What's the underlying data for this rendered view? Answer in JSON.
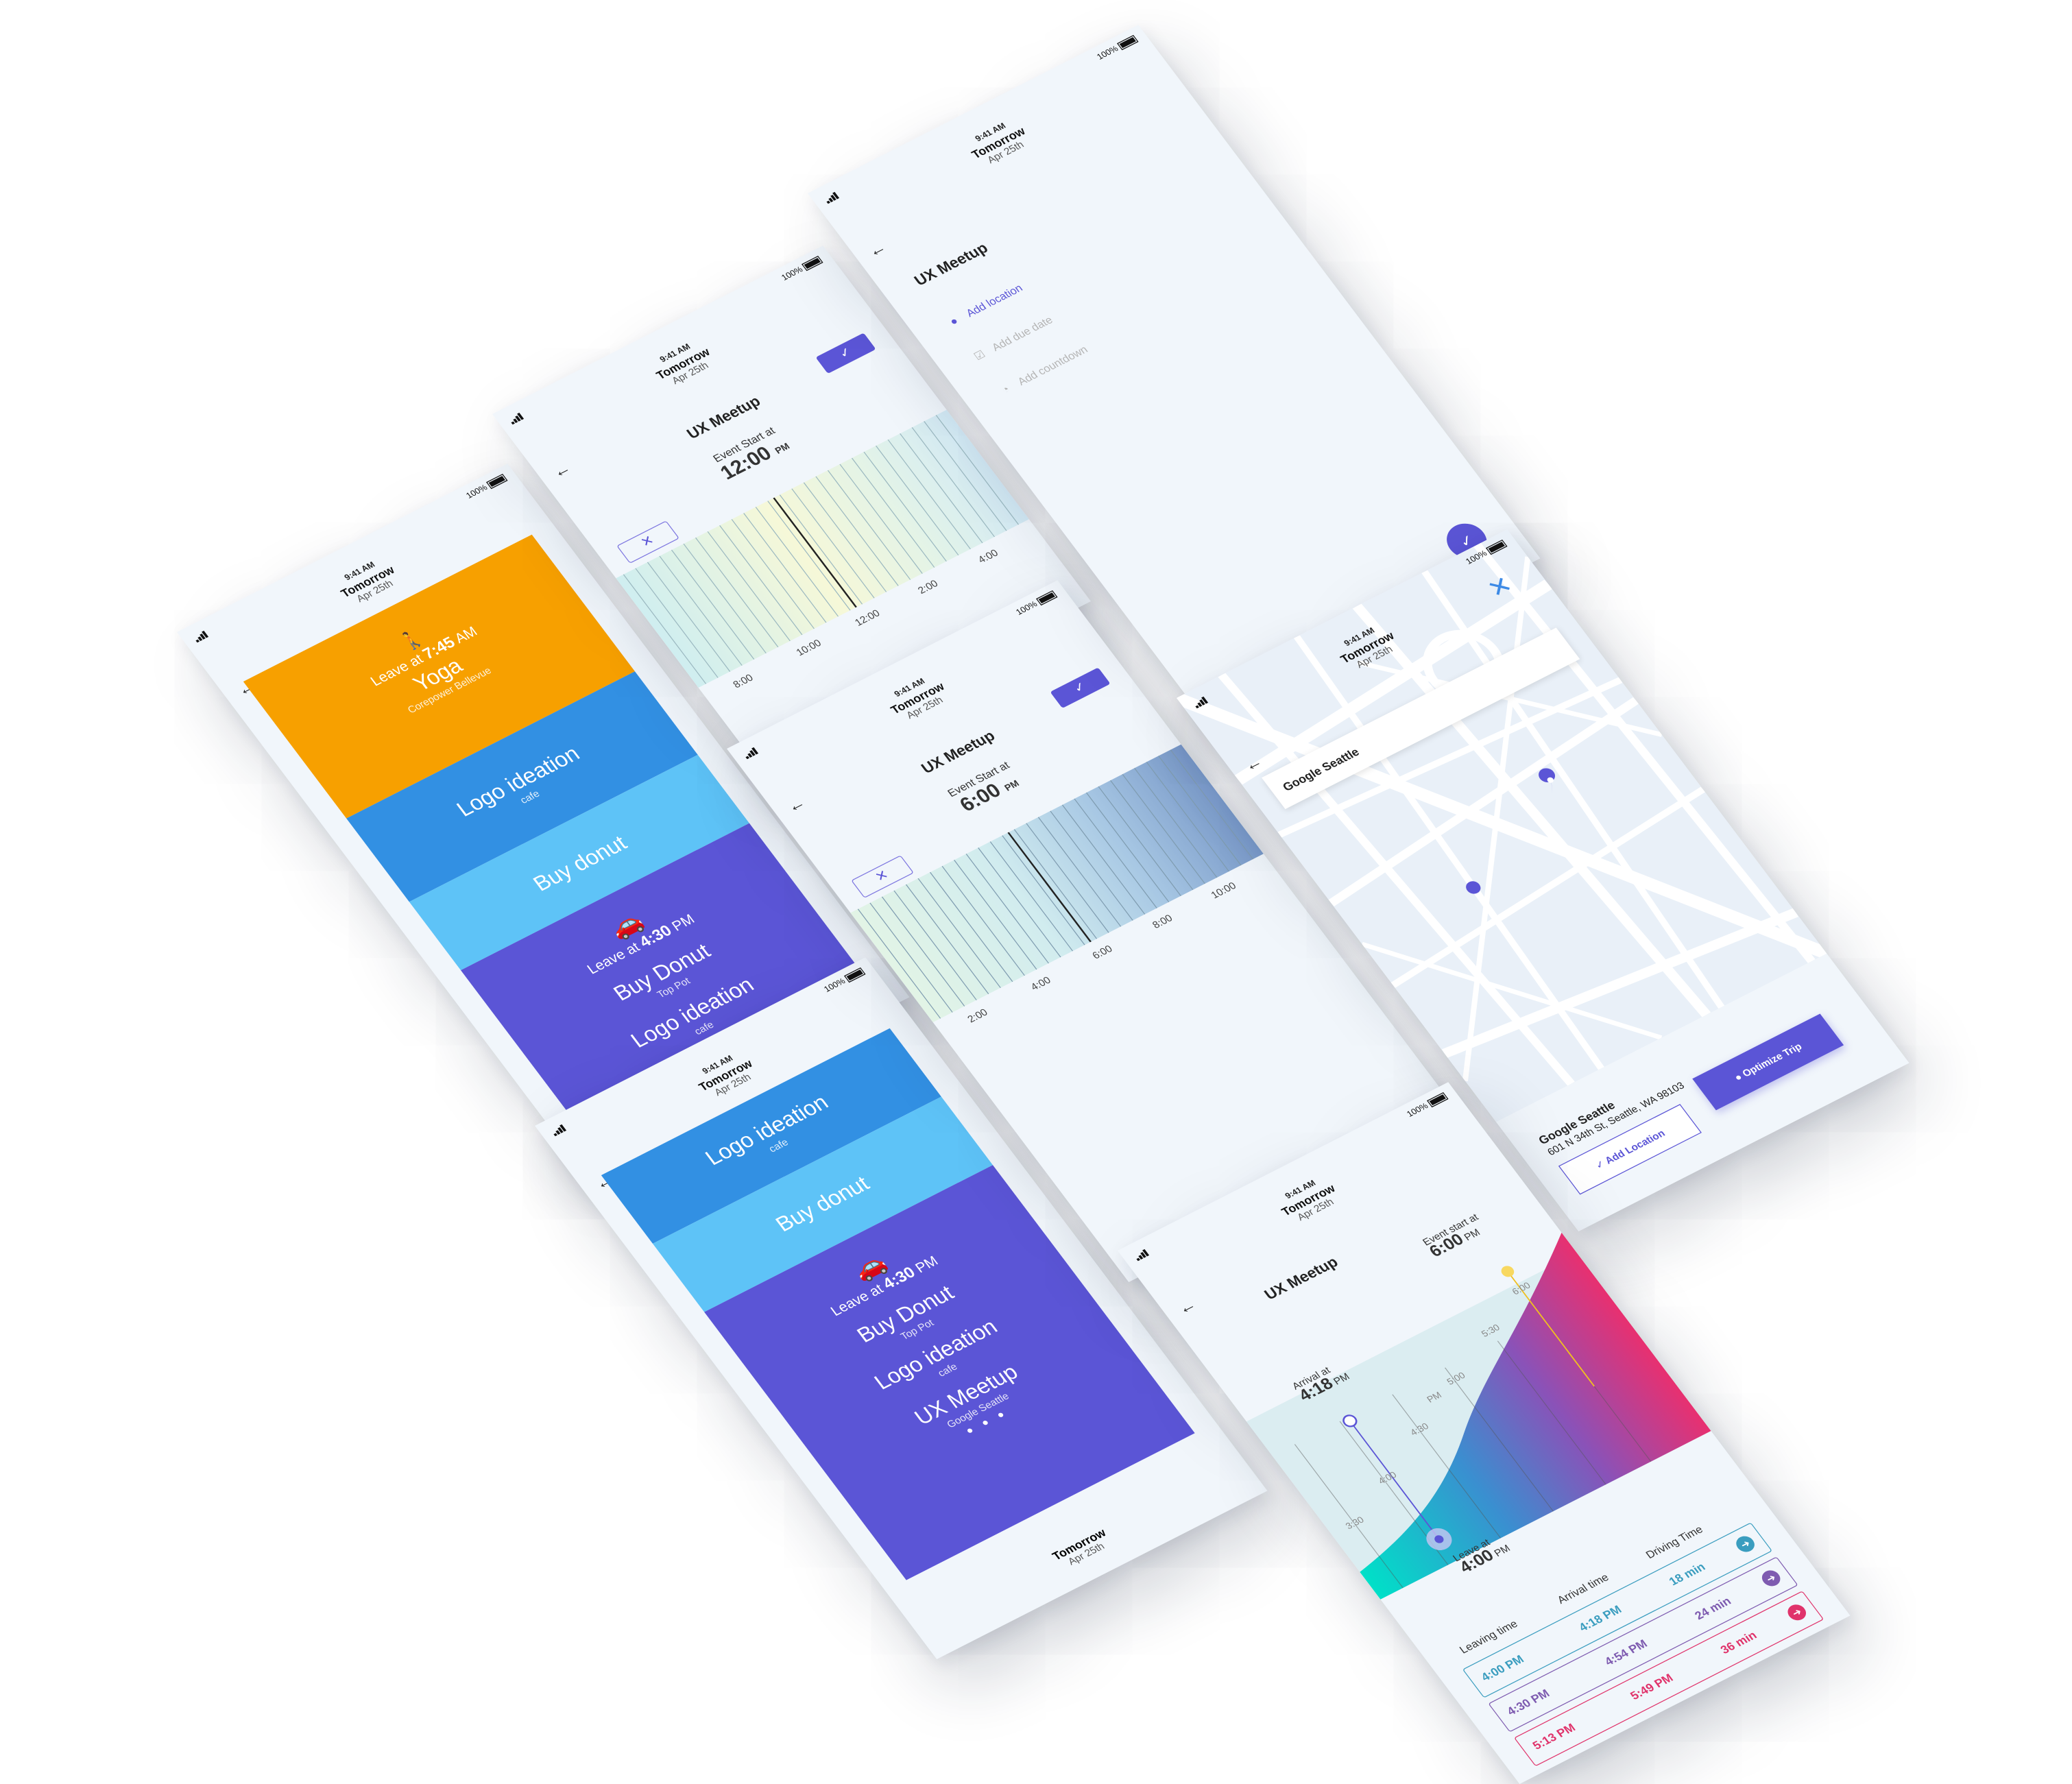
{
  "status": {
    "time": "9:41 AM",
    "battery": "100%"
  },
  "header": {
    "day": "Tomorrow",
    "date": "Apr 25th"
  },
  "schedule": {
    "yoga": {
      "lead_pre": "Leave at",
      "lead_time": "7:45",
      "lead_ampm": "AM",
      "name": "Yoga",
      "sub": "Corepower Bellevue"
    },
    "logo": {
      "name": "Logo ideation",
      "sub": "cafe"
    },
    "donut": {
      "name": "Buy donut"
    },
    "trip": {
      "lead_pre": "Leave at",
      "lead_time": "4:30",
      "lead_ampm": "PM",
      "name1": "Buy Donut",
      "sub1": "Top Pot",
      "name2": "Logo ideation",
      "sub2": "cafe"
    }
  },
  "schedule2": {
    "logo": {
      "name": "Logo ideation",
      "sub": "cafe"
    },
    "donut": {
      "name": "Buy donut"
    },
    "trip": {
      "lead_pre": "Leave at",
      "lead_time": "4:30",
      "lead_ampm": "PM",
      "name1": "Buy Donut",
      "sub1": "Top Pot",
      "name2": "Logo ideation",
      "sub2": "cafe",
      "name3": "UX Meetup",
      "sub3": "Google Seattle",
      "more": "• • •"
    },
    "footer_day": "Tomorrow",
    "footer_date": "Apr 25th"
  },
  "picker1": {
    "title": "UX Meetup",
    "event_label": "Event Start at",
    "event_time": "12:00",
    "event_ampm": "PM",
    "ticks": [
      "8:00",
      "10:00",
      "12:00",
      "2:00",
      "4:00"
    ]
  },
  "picker2": {
    "title": "UX Meetup",
    "event_label": "Event Start at",
    "event_time": "6:00",
    "event_ampm": "PM",
    "ticks": [
      "2:00",
      "4:00",
      "6:00",
      "8:00",
      "10:00"
    ]
  },
  "icons": {
    "cancel": "✕",
    "confirm": "✓",
    "back": "←",
    "walk": "🚶",
    "car": "🚗"
  },
  "task": {
    "title": "UX Meetup",
    "options": [
      {
        "label": "Add location",
        "icon": "pin-icon",
        "glyph": "●"
      },
      {
        "label": "Add due date",
        "icon": "calendar-check-icon",
        "glyph": "☑"
      },
      {
        "label": "Add countdown",
        "icon": "stopwatch-icon",
        "glyph": "◔"
      }
    ]
  },
  "map": {
    "search": "Google Seattle",
    "place_name": "Google Seattle",
    "place_address": "601 N 34th St, Seattle, WA 98103",
    "add_location": "Add Location",
    "optimize": "Optimize Trip",
    "close": "✕"
  },
  "route": {
    "title": "UX Meetup",
    "arrival_label": "Arrival at",
    "arrival_time": "4:18",
    "arrival_ampm": "PM",
    "event_label": "Event start at",
    "event_time": "6:00",
    "event_ampm": "PM",
    "leave_label": "Leave at",
    "leave_time": "4:00",
    "leave_ampm": "PM",
    "grid": [
      "3:30",
      "4:00",
      "4:30",
      "PM",
      "5:00",
      "5:30",
      "6:00"
    ],
    "columns": [
      "Leaving time",
      "Arrival time",
      "Driving Time"
    ],
    "rows": [
      {
        "leave": "4:00 PM",
        "arrive": "4:18 PM",
        "drive": "18 min",
        "color": "#3a9dbf"
      },
      {
        "leave": "4:30 PM",
        "arrive": "4:54 PM",
        "drive": "24 min",
        "color": "#7e5bb0"
      },
      {
        "leave": "5:13 PM",
        "arrive": "5:49 PM",
        "drive": "36 min",
        "color": "#e0336b"
      }
    ]
  },
  "colors": {
    "purple": "#5b55d6",
    "orange": "#f7a000",
    "blue": "#3290e3",
    "light_blue": "#5ec3f7",
    "pink": "#e0336b",
    "teal": "#00d8c7"
  }
}
